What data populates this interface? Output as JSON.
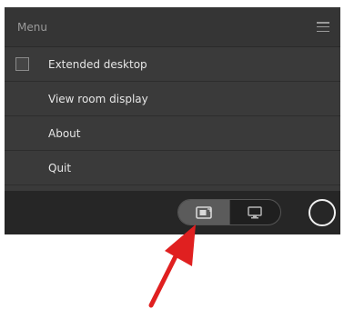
{
  "menu": {
    "title": "Menu",
    "items": [
      {
        "label": "Extended desktop",
        "has_checkbox": true,
        "checked": false
      },
      {
        "label": "View room display",
        "has_checkbox": false
      },
      {
        "label": "About",
        "has_checkbox": false
      },
      {
        "label": "Quit",
        "has_checkbox": false
      }
    ]
  },
  "footer": {
    "toggle": {
      "selected": "share-screen",
      "segments": [
        "share-screen-icon",
        "monitor-icon"
      ]
    },
    "circle_button": "circle-icon"
  },
  "annotation": {
    "arrow_color": "#e02020"
  },
  "colors": {
    "panel_bg": "#3a3a3a",
    "footer_bg": "#262626",
    "text": "#e6e6e6"
  }
}
